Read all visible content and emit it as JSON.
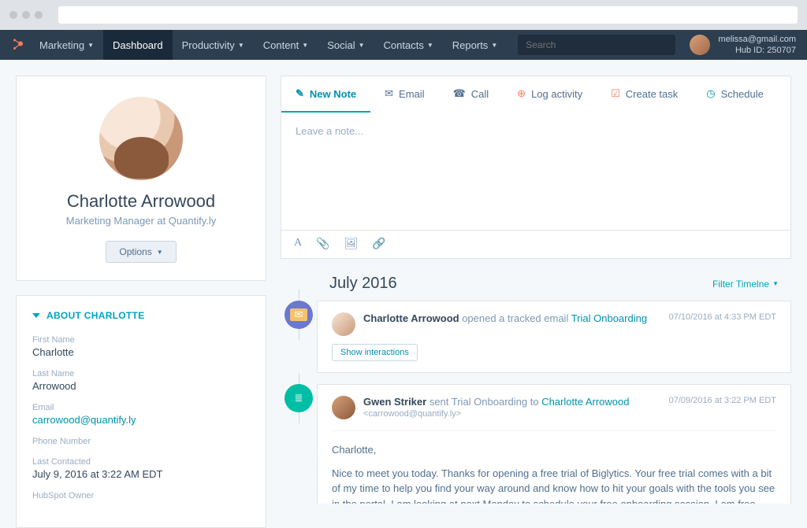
{
  "nav": {
    "primary": "Marketing",
    "items": [
      "Dashboard",
      "Productivity",
      "Content",
      "Social",
      "Contacts",
      "Reports"
    ],
    "active_index": 0,
    "search_placeholder": "Search",
    "account_email": "melissa@gmail.com",
    "hub_id_label": "Hub ID: 250707"
  },
  "profile": {
    "name": "Charlotte Arrowood",
    "role": "Marketing Manager at Quantify.ly",
    "options_label": "Options"
  },
  "about": {
    "heading": "ABOUT CHARLOTTE",
    "first_name_label": "First Name",
    "first_name": "Charlotte",
    "last_name_label": "Last Name",
    "last_name": "Arrowood",
    "email_label": "Email",
    "email": "carrowood@quantify.ly",
    "phone_label": "Phone Number",
    "phone": "",
    "last_contacted_label": "Last Contacted",
    "last_contacted": "July 9, 2016 at 3:22 AM EDT",
    "owner_label": "HubSpot Owner"
  },
  "tabs": {
    "new_note": "New Note",
    "email": "Email",
    "call": "Call",
    "log": "Log activity",
    "task": "Create task",
    "schedule": "Schedule"
  },
  "note": {
    "placeholder": "Leave a note..."
  },
  "timeline": {
    "month": "July 2016",
    "filter_label": "Filter Timelne",
    "event1": {
      "actor": "Charlotte Arrowood",
      "action": " opened a tracked email ",
      "subject": "Trial Onboarding",
      "date": "07/10/2016 at 4:33 PM EDT",
      "show_label": "Show interactions"
    },
    "event2": {
      "actor": "Gwen Striker",
      "action": " sent Trial Onboarding to ",
      "recipient": "Charlotte Arrowood",
      "sub": "<carrowood@quantify.ly>",
      "date": "07/09/2016 at 3:22 PM EDT",
      "greeting": "Charlotte,",
      "body": "Nice to meet you today.  Thanks for opening a free trial of Biglytics.  Your free trial comes with a bit of my time to help you find your way around and know how to hit your goals with the tools you see in the portal.  I am looking at next Monday to schedule your free onboarding session.  I am free"
    }
  }
}
